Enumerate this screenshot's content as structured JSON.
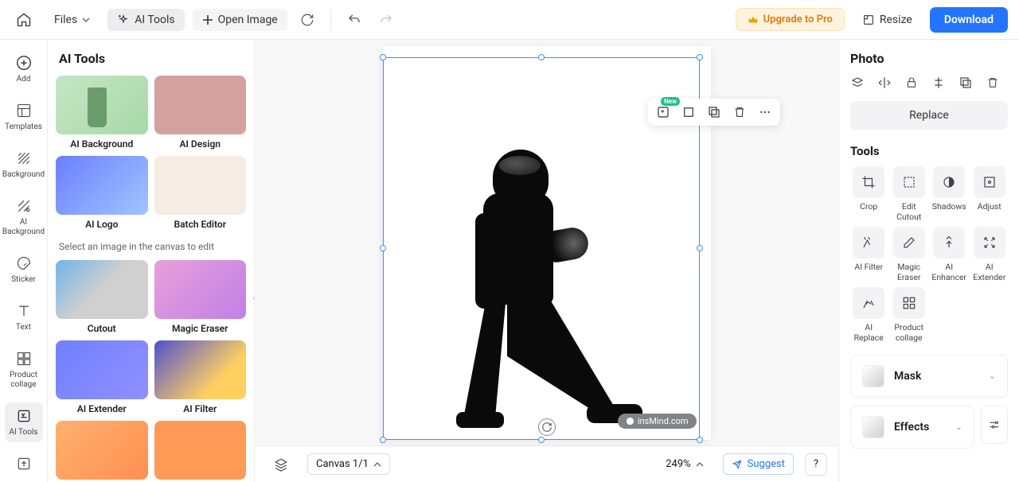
{
  "topbar": {
    "files_label": "Files",
    "ai_tools_label": "AI Tools",
    "open_image_label": "Open Image",
    "upgrade_label": "Upgrade to Pro",
    "resize_label": "Resize",
    "download_label": "Download"
  },
  "left_rail": {
    "add": "Add",
    "templates": "Templates",
    "background": "Background",
    "ai_background": "AI Background",
    "sticker": "Sticker",
    "text": "Text",
    "product_collage": "Product collage",
    "ai_tools": "AI Tools"
  },
  "ai_panel": {
    "title": "AI Tools",
    "hint": "Select an image in the canvas to edit",
    "cards": {
      "ai_background": "AI Background",
      "ai_design": "AI Design",
      "ai_logo": "AI Logo",
      "batch_editor": "Batch Editor",
      "cutout": "Cutout",
      "magic_eraser": "Magic Eraser",
      "ai_extender": "AI Extender",
      "ai_filter": "AI Filter"
    }
  },
  "floating": {
    "new_badge": "New"
  },
  "bottom": {
    "canvas_label": "Canvas 1/1",
    "zoom": "249%",
    "suggest": "Suggest",
    "help": "?"
  },
  "watermark": "insMind.com",
  "right": {
    "title": "Photo",
    "replace": "Replace",
    "tools_title": "Tools",
    "tools": {
      "crop": "Crop",
      "edit_cutout": "Edit Cutout",
      "shadows": "Shadows",
      "adjust": "Adjust",
      "ai_filter": "AI Filter",
      "magic_eraser": "Magic Eraser",
      "ai_enhancer": "AI Enhancer",
      "ai_extender": "AI Extender",
      "ai_replace": "AI Replace",
      "product_collage": "Product collage"
    },
    "mask": "Mask",
    "effects": "Effects"
  }
}
